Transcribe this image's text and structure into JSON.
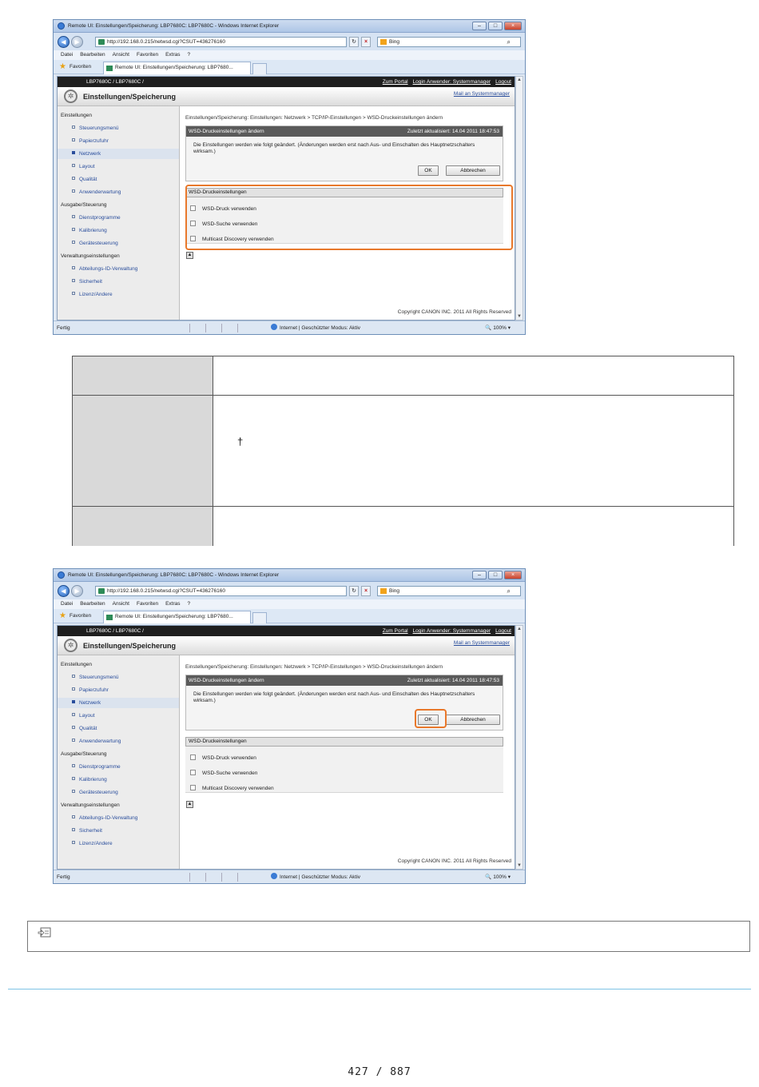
{
  "browser": {
    "title": "Remote UI: Einstellungen/Speicherung: LBP7680C: LBP7680C - Windows Internet Explorer",
    "address": "http://192.168.0.215/netwsd.cgi?CSUT=436276160",
    "search_placeholder": "Bing",
    "menu": [
      "Datei",
      "Bearbeiten",
      "Ansicht",
      "Favoriten",
      "Extras",
      "?"
    ],
    "favorites_label": "Favoriten",
    "tab_title": "Remote UI: Einstellungen/Speicherung: LBP7680...",
    "status": {
      "left": "Fertig",
      "zone": "Internet | Geschützter Modus: Aktiv",
      "zoom": "100%"
    }
  },
  "remote_ui": {
    "model": "LBP7680C / LBP7680C /",
    "links": [
      "Zum Portal",
      "Login Anwender: Systemmanager",
      "Logout"
    ],
    "page_title": "Einstellungen/Speicherung",
    "mail_link": "Mail an Systemmanager",
    "sidebar": [
      {
        "label": "Einstellungen",
        "type": "cat"
      },
      {
        "label": "Steuerungsmenü",
        "type": "sub"
      },
      {
        "label": "Papierzufuhr",
        "type": "sub"
      },
      {
        "label": "Netzwerk",
        "type": "sub",
        "active": true
      },
      {
        "label": "Layout",
        "type": "sub"
      },
      {
        "label": "Qualität",
        "type": "sub"
      },
      {
        "label": "Anwenderwartung",
        "type": "sub"
      },
      {
        "label": "Ausgabe/Steuerung",
        "type": "cat"
      },
      {
        "label": "Dienstprogramme",
        "type": "sub"
      },
      {
        "label": "Kalibrierung",
        "type": "sub"
      },
      {
        "label": "Gerätesteuerung",
        "type": "sub"
      },
      {
        "label": "Verwaltungseinstellungen",
        "type": "cat"
      },
      {
        "label": "Abteilungs-ID-Verwaltung",
        "type": "sub"
      },
      {
        "label": "Sicherheit",
        "type": "sub"
      },
      {
        "label": "Lizenz/Andere",
        "type": "sub"
      }
    ],
    "breadcrumb": "Einstellungen/Speicherung: Einstellungen: Netzwerk > TCP/IP-Einstellungen > WSD-Druckeinstellungen ändern",
    "edit_header": "WSD-Druckeinstellungen ändern",
    "last_updated": "Zuletzt aktualisiert: 14.04 2011 18:47:53",
    "message": "Die Einstellungen werden wie folgt geändert. (Änderungen werden erst nach Aus- und Einschalten des Hauptnetzschalters wirksam.)",
    "ok_label": "OK",
    "cancel_label": "Abbrechen",
    "settings_header": "WSD-Druckeinstellungen",
    "checkboxes": [
      {
        "label": "WSD-Druck verwenden",
        "checked": false
      },
      {
        "label": "WSD-Suche verwenden",
        "checked": false
      },
      {
        "label": "Multicast Discovery verwenden",
        "checked": false
      }
    ],
    "copyright": "Copyright CANON INC. 2011 All Rights Reserved"
  },
  "footer": {
    "page_number": "427 / 887"
  }
}
